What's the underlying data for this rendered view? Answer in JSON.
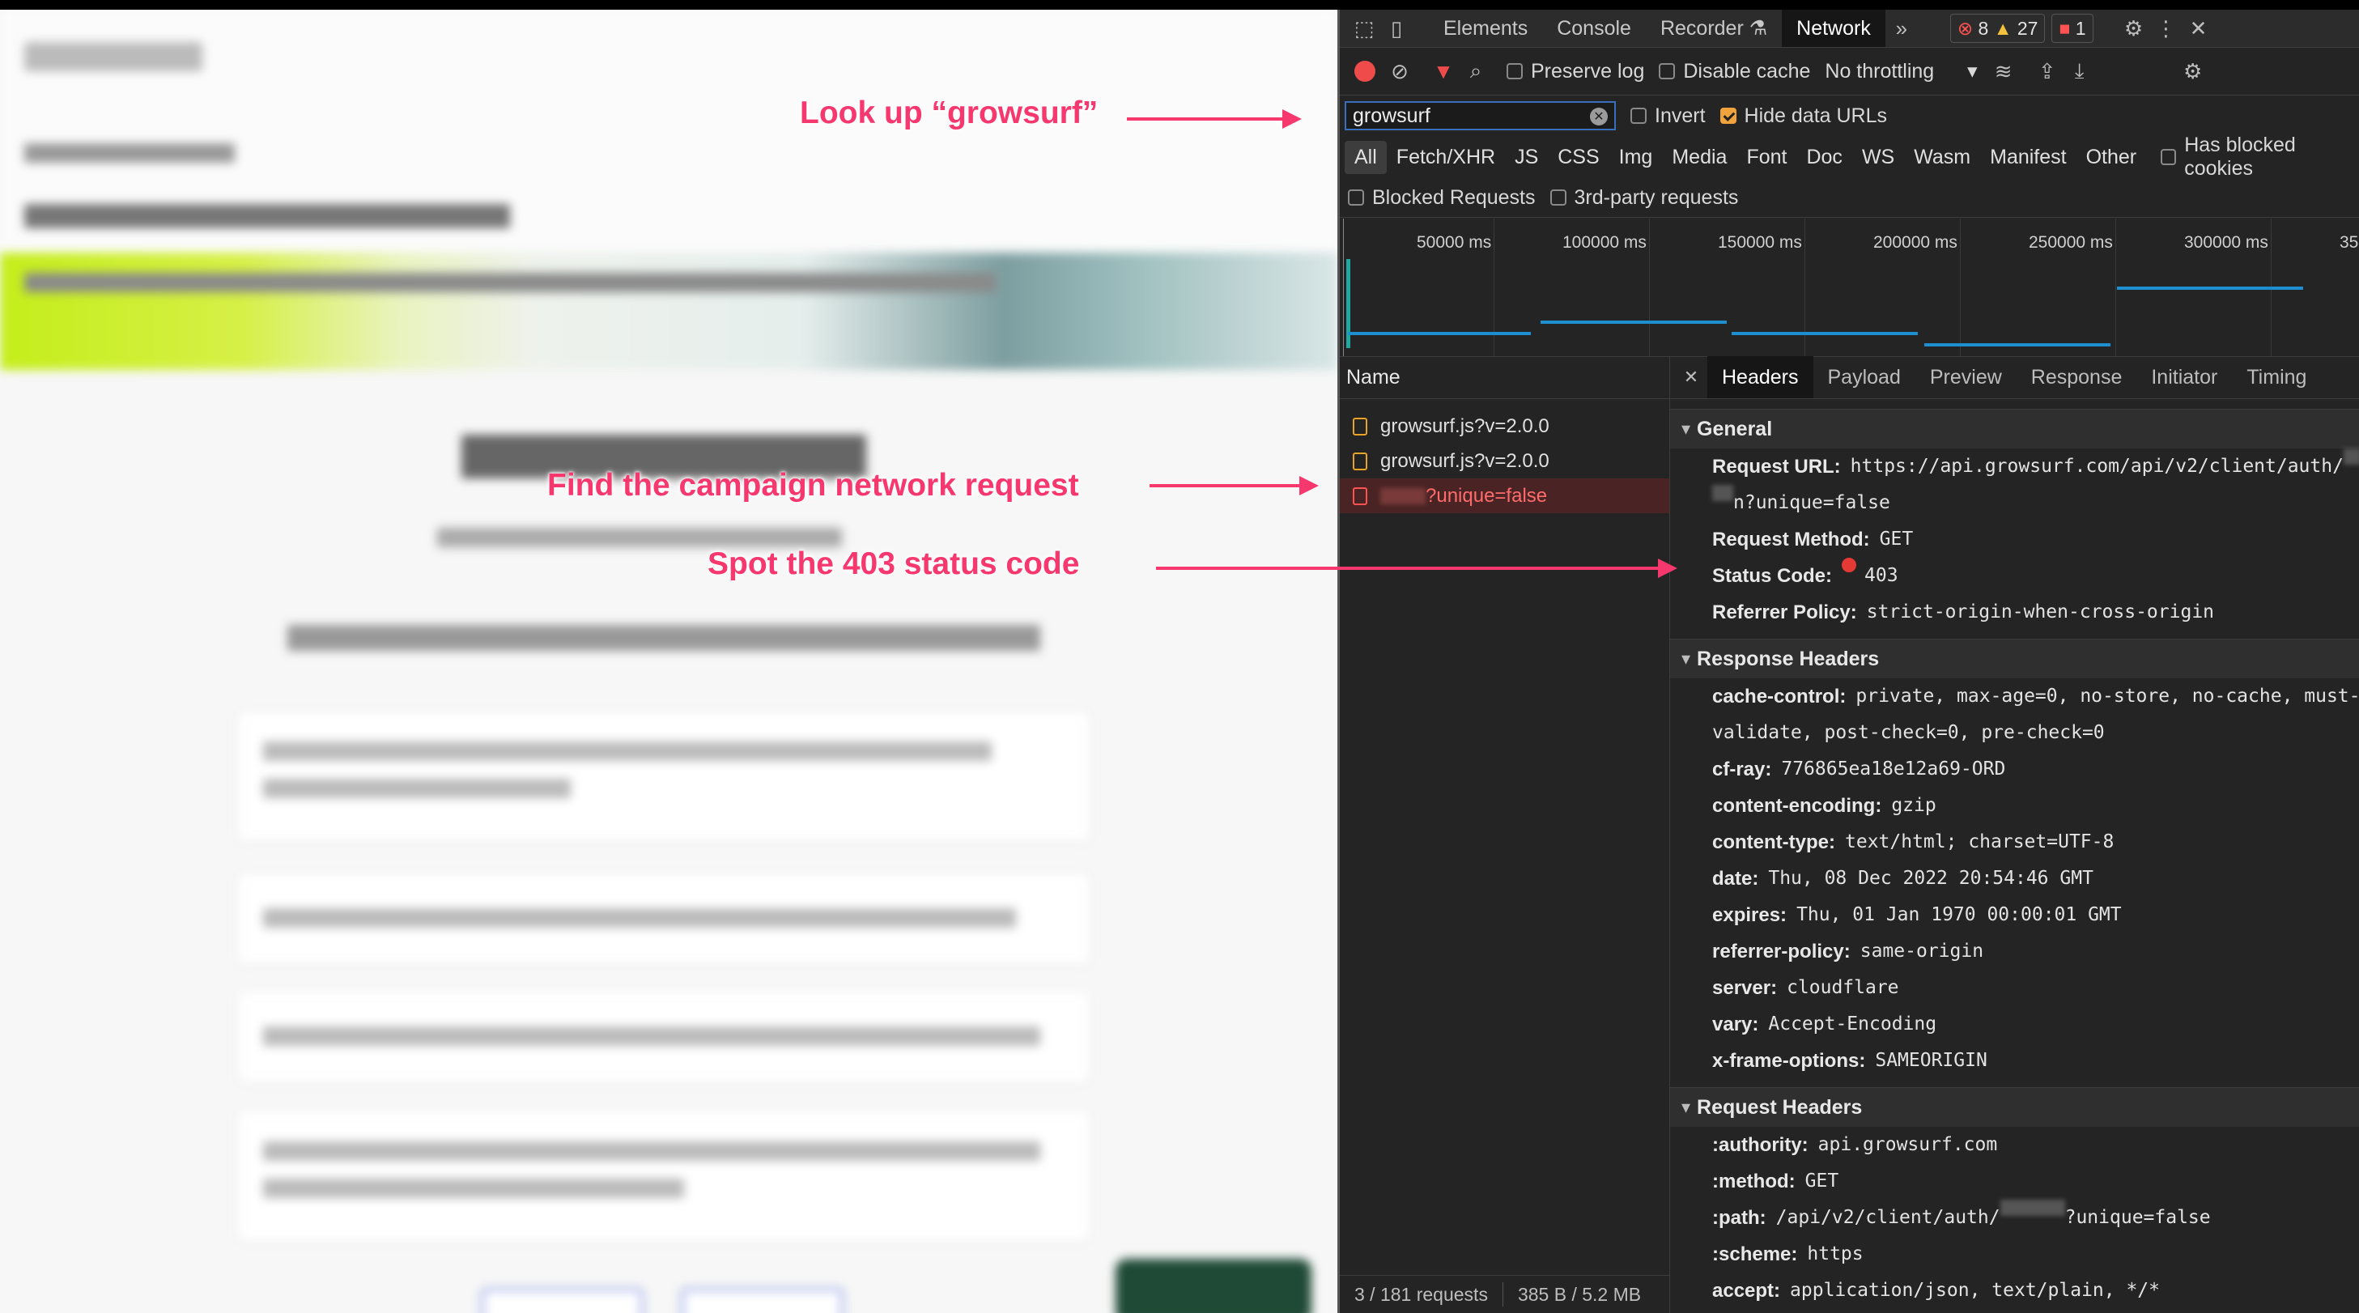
{
  "devtools": {
    "tabs": [
      "Elements",
      "Console",
      "Recorder",
      "Network"
    ],
    "active_tab": "Network",
    "error_count": "8",
    "warning_count": "27",
    "issue_count": "1",
    "preserve_log": "Preserve log",
    "disable_cache": "Disable cache",
    "throttling": "No throttling",
    "filter_value": "growsurf",
    "invert": "Invert",
    "hide_data_urls": "Hide data URLs",
    "types": [
      "All",
      "Fetch/XHR",
      "JS",
      "CSS",
      "Img",
      "Media",
      "Font",
      "Doc",
      "WS",
      "Wasm",
      "Manifest",
      "Other"
    ],
    "has_blocked_cookies": "Has blocked cookies",
    "blocked_requests": "Blocked Requests",
    "third_party": "3rd-party requests",
    "timeline_ticks": [
      "50000 ms",
      "100000 ms",
      "150000 ms",
      "200000 ms",
      "250000 ms",
      "300000 ms",
      "35"
    ],
    "name_header": "Name",
    "requests": [
      "growsurf.js?v=2.0.0",
      "growsurf.js?v=2.0.0",
      "?unique=false"
    ],
    "status_requests": "3 / 181 requests",
    "status_size": "385 B / 5.2 MB",
    "detail_tabs": [
      "Headers",
      "Payload",
      "Preview",
      "Response",
      "Initiator",
      "Timing"
    ],
    "general_title": "General",
    "general": {
      "url_key": "Request URL:",
      "url_val": "https://api.growsurf.com/api/v2/client/auth/",
      "url_cont": "n?unique=false",
      "method_key": "Request Method:",
      "method_val": "GET",
      "status_key": "Status Code:",
      "status_val": "403",
      "referrer_key": "Referrer Policy:",
      "referrer_val": "strict-origin-when-cross-origin"
    },
    "response_title": "Response Headers",
    "response_headers": [
      {
        "k": "cache-control:",
        "v": "private, max-age=0, no-store, no-cache, must-"
      },
      {
        "k": "",
        "v": "validate, post-check=0, pre-check=0"
      },
      {
        "k": "cf-ray:",
        "v": "776865ea18e12a69-ORD"
      },
      {
        "k": "content-encoding:",
        "v": "gzip"
      },
      {
        "k": "content-type:",
        "v": "text/html; charset=UTF-8"
      },
      {
        "k": "date:",
        "v": "Thu, 08 Dec 2022 20:54:46 GMT"
      },
      {
        "k": "expires:",
        "v": "Thu, 01 Jan 1970 00:00:01 GMT"
      },
      {
        "k": "referrer-policy:",
        "v": "same-origin"
      },
      {
        "k": "server:",
        "v": "cloudflare"
      },
      {
        "k": "vary:",
        "v": "Accept-Encoding"
      },
      {
        "k": "x-frame-options:",
        "v": "SAMEORIGIN"
      }
    ],
    "request_title": "Request Headers",
    "request_headers": [
      {
        "k": ":authority:",
        "v": "api.growsurf.com"
      },
      {
        "k": ":method:",
        "v": "GET"
      },
      {
        "k": ":path:",
        "v": "/api/v2/client/auth/",
        "v2": "?unique=false"
      },
      {
        "k": ":scheme:",
        "v": "https"
      },
      {
        "k": "accept:",
        "v": "application/json, text/plain, */*"
      }
    ]
  },
  "annotations": {
    "a1": "Look up “growsurf”",
    "a2": "Find the campaign network request",
    "a3": "Spot the 403 status code"
  },
  "colors": {
    "accent": "#f6386f",
    "link_blue": "#1d8fd1",
    "error_red": "#e53935"
  }
}
